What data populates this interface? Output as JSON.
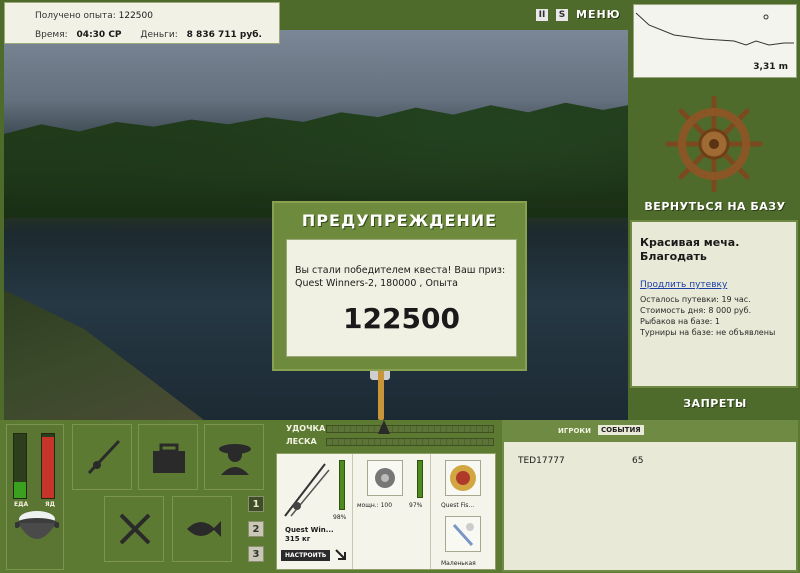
{
  "top_info": {
    "xp_label": "Получено опыта:",
    "xp_value": "122500",
    "time_label": "Время:",
    "time_value": "04:30 СР",
    "money_label": "Деньги:",
    "money_value": "8 836 711 руб."
  },
  "top_controls": {
    "pause": "II",
    "sound": "S",
    "menu": "МЕНЮ"
  },
  "map": {
    "depth": "3,31 m"
  },
  "base_button": "ВЕРНУТЬСЯ НА БАЗУ",
  "base_info": {
    "title": "Красивая меча. Благодать",
    "extend_link": "Продлить путевку",
    "rows": [
      "Осталось путевки: 19 час.",
      "Стоимость дня: 8 000 руб.",
      "Рыбаков на базе: 1",
      "Турниры на базе: не объявлены"
    ]
  },
  "bans_button": "ЗАПРЕТЫ",
  "warning": {
    "title": "ПРЕДУПРЕЖДЕНИЕ",
    "message": "Вы стали победителем квеста! Ваш приз: Quest Winners-2, 180000 , Опыта",
    "amount": "122500"
  },
  "meters": {
    "food_label": "ЕДА",
    "food_level": 0.25,
    "poison_label": "ЯД",
    "poison_level": 0.95,
    "colors": {
      "food": "#39a11d",
      "poison": "#c7352a"
    }
  },
  "tools": {
    "icons": [
      "rod-icon",
      "tackle-box-icon",
      "fisherman-icon",
      "food-icon",
      "fish-icon"
    ]
  },
  "pages": [
    "1",
    "2",
    "3"
  ],
  "gauges": {
    "rod_label": "УДОЧКА",
    "line_label": "ЛЕСКА"
  },
  "rod": {
    "name": "Quest Win...",
    "weight": "315 кг",
    "percent": "98%",
    "setup": "НАСТРОИТЬ",
    "reel_power": "мощн.: 100",
    "reel_percent": "97%",
    "line_name": "Quest Fis...",
    "lure_name": "Маленькая"
  },
  "events": {
    "tab_players": "ИГРОКИ",
    "tab_events": "СОБЫТИЯ",
    "player_name": "TED17777",
    "player_value": "65"
  }
}
